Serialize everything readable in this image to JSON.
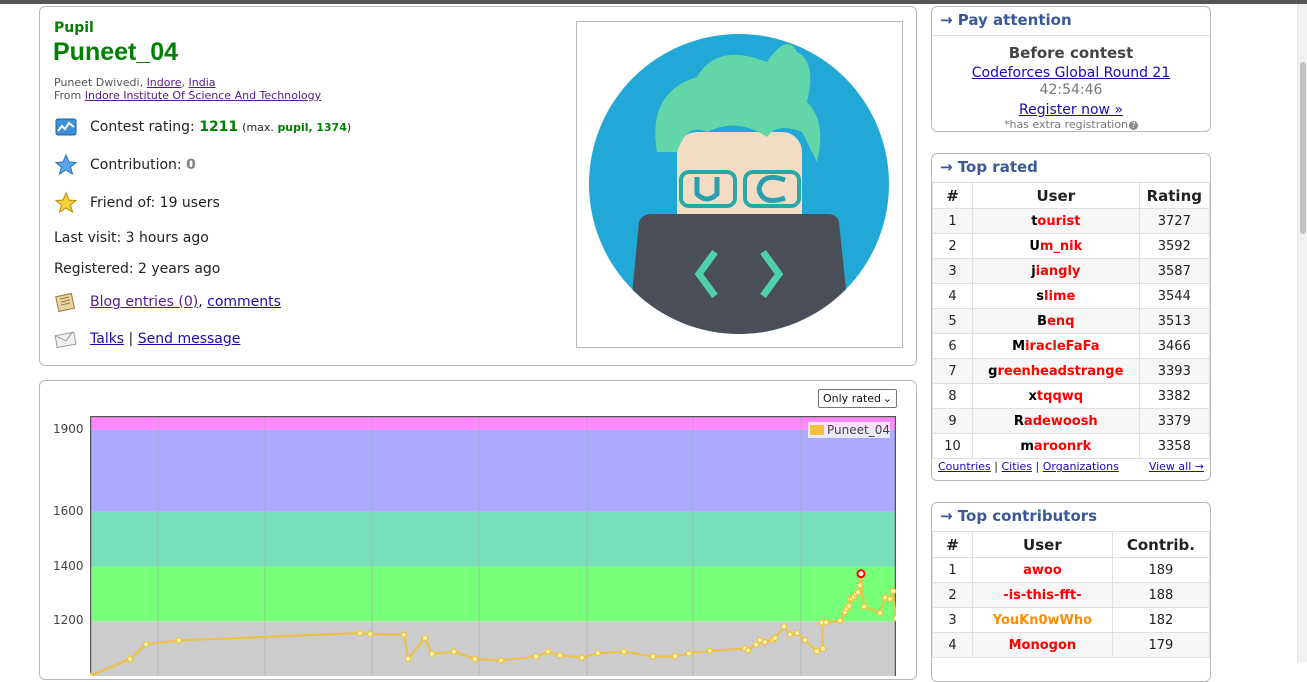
{
  "profile": {
    "rank": "Pupil",
    "handle": "Puneet_04",
    "name_prefix": "Puneet Dwivedi, ",
    "city": "Indore",
    "country": "India",
    "from_prefix": "From ",
    "organization": "Indore Institute Of Science And Technology",
    "rating_label": "Contest rating:",
    "rating_value": "1211",
    "max_prefix": "(max.",
    "max_rank": "pupil,",
    "max_value": "1374",
    "max_suffix": ")",
    "contribution_label": "Contribution:",
    "contribution_value": "0",
    "friend_text": "Friend of: 19 users",
    "last_visit": "Last visit: 3 hours ago",
    "registered": "Registered: 2 years ago",
    "blog_entries": "Blog entries (0)",
    "comments": "comments",
    "talks": "Talks",
    "send_message": "Send message"
  },
  "graph": {
    "filter_selected": "Only rated",
    "legend": "Puneet_04"
  },
  "chart_data": {
    "type": "line",
    "ylim": [
      1000,
      1950
    ],
    "yticks": [
      1200,
      1400,
      1600,
      1900
    ],
    "bands": [
      {
        "from": 1000,
        "to": 1200,
        "color": "#cccccc"
      },
      {
        "from": 1200,
        "to": 1400,
        "color": "#77ff77"
      },
      {
        "from": 1400,
        "to": 1600,
        "color": "#77ddbb"
      },
      {
        "from": 1600,
        "to": 1900,
        "color": "#aaaaff"
      },
      {
        "from": 1900,
        "to": 1950,
        "color": "#ff88ff"
      }
    ],
    "series": [
      {
        "name": "Puneet_04",
        "color": "#edc240",
        "values": [
          1000,
          1062,
          1116,
          1130,
          1157,
          1153,
          1151,
          1063,
          1139,
          1081,
          1089,
          1062,
          1057,
          1071,
          1089,
          1076,
          1067,
          1083,
          1089,
          1071,
          1072,
          1082,
          1092,
          1101,
          1094,
          1115,
          1131,
          1124,
          1133,
          1139,
          1181,
          1152,
          1157,
          1131,
          1091,
          1100,
          1195,
          1196,
          1202,
          1233,
          1248,
          1256,
          1282,
          1283,
          1290,
          1300,
          1306,
          1331,
          1374,
          1254,
          1230,
          1287,
          1282,
          1310,
          1211
        ],
        "max_index": 48
      }
    ]
  },
  "sidebar": {
    "pay": {
      "title": "→ Pay attention",
      "before": "Before contest",
      "contest": "Codeforces Global Round 21",
      "timer": "42:54:46",
      "register": "Register now »",
      "extra": "*has extra registration"
    },
    "top_rated": {
      "title": "→ Top rated",
      "headers": [
        "#",
        "User",
        "Rating"
      ],
      "rows": [
        {
          "n": "1",
          "first": "t",
          "rest": "ourist",
          "v": "3727"
        },
        {
          "n": "2",
          "first": "U",
          "rest": "m_nik",
          "v": "3592"
        },
        {
          "n": "3",
          "first": "j",
          "rest": "iangly",
          "v": "3587"
        },
        {
          "n": "4",
          "first": "s",
          "rest": "lime",
          "v": "3544"
        },
        {
          "n": "5",
          "first": "B",
          "rest": "enq",
          "v": "3513"
        },
        {
          "n": "6",
          "first": "M",
          "rest": "iracleFaFa",
          "v": "3466"
        },
        {
          "n": "7",
          "first": "g",
          "rest": "reenheadstrange",
          "v": "3393"
        },
        {
          "n": "8",
          "first": "x",
          "rest": "tqqwq",
          "v": "3382"
        },
        {
          "n": "9",
          "first": "R",
          "rest": "adewoosh",
          "v": "3379"
        },
        {
          "n": "10",
          "first": "m",
          "rest": "aroonrk",
          "v": "3358"
        }
      ],
      "footer_countries": "Countries",
      "footer_cities": "Cities",
      "footer_orgs": "Organizations",
      "view_all": "View all →"
    },
    "top_contributors": {
      "title": "→ Top contributors",
      "headers": [
        "#",
        "User",
        "Contrib."
      ],
      "rows": [
        {
          "n": "1",
          "u": "awoo",
          "v": "189",
          "color": "red"
        },
        {
          "n": "2",
          "u": "-is-this-fft-",
          "v": "188",
          "color": "red"
        },
        {
          "n": "3",
          "u": "YouKn0wWho",
          "v": "182",
          "color": "orange"
        },
        {
          "n": "4",
          "u": "Monogon",
          "v": "179",
          "color": "red"
        }
      ]
    }
  }
}
